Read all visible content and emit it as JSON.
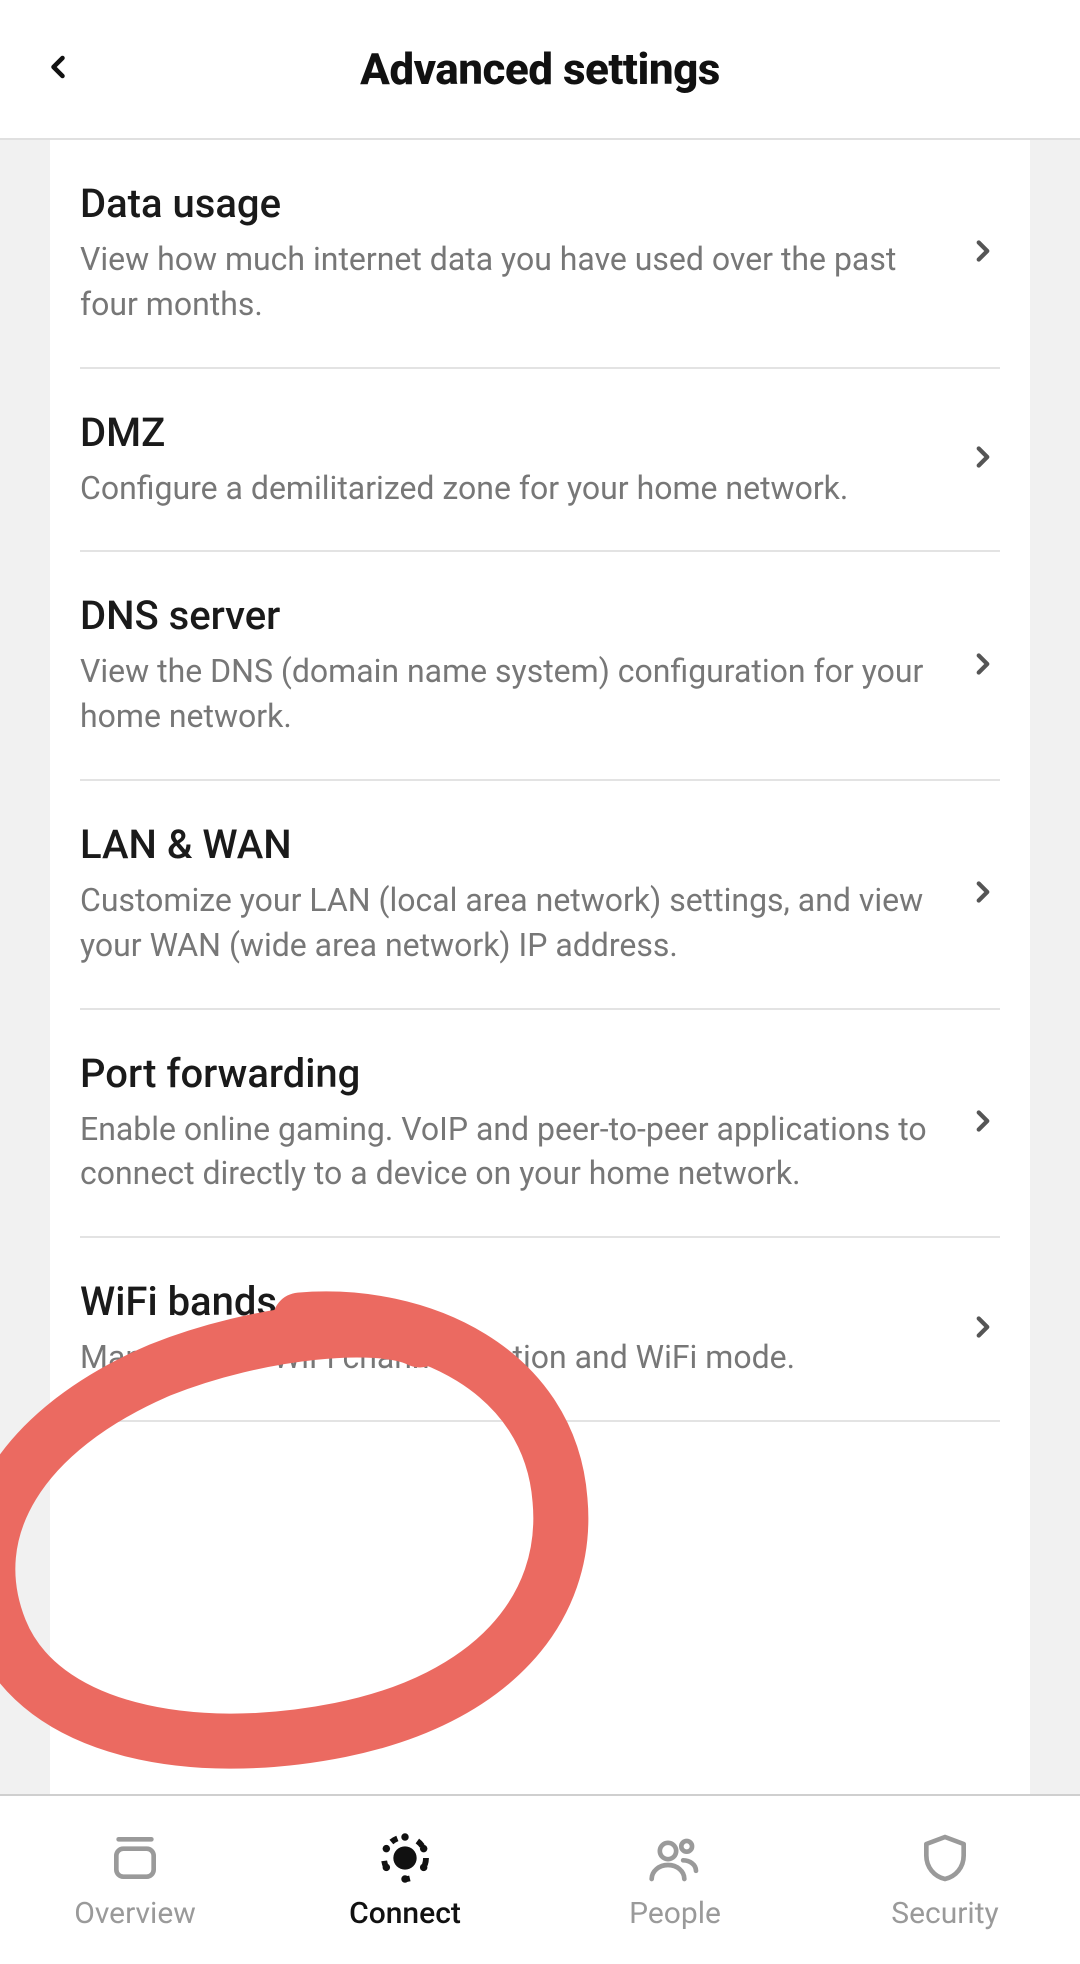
{
  "header": {
    "title": "Advanced settings"
  },
  "rows": [
    {
      "title": "Data usage",
      "desc": "View how much internet data you have used over the past four months."
    },
    {
      "title": "DMZ",
      "desc": "Configure a demilitarized zone for your home network."
    },
    {
      "title": "DNS server",
      "desc": "View the DNS (domain name system) configuration for your home network."
    },
    {
      "title": "LAN & WAN",
      "desc": "Customize your LAN (local area network) settings, and view your WAN (wide area network) IP address."
    },
    {
      "title": "Port forwarding",
      "desc": "Enable online gaming. VoIP and peer-to-peer applications to connect directly to a device on your home network."
    },
    {
      "title": "WiFi bands",
      "desc": "Manage your WiFi channel section and WiFi mode."
    }
  ],
  "nav": {
    "overview": "Overview",
    "connect": "Connect",
    "people": "People",
    "security": "Security"
  }
}
